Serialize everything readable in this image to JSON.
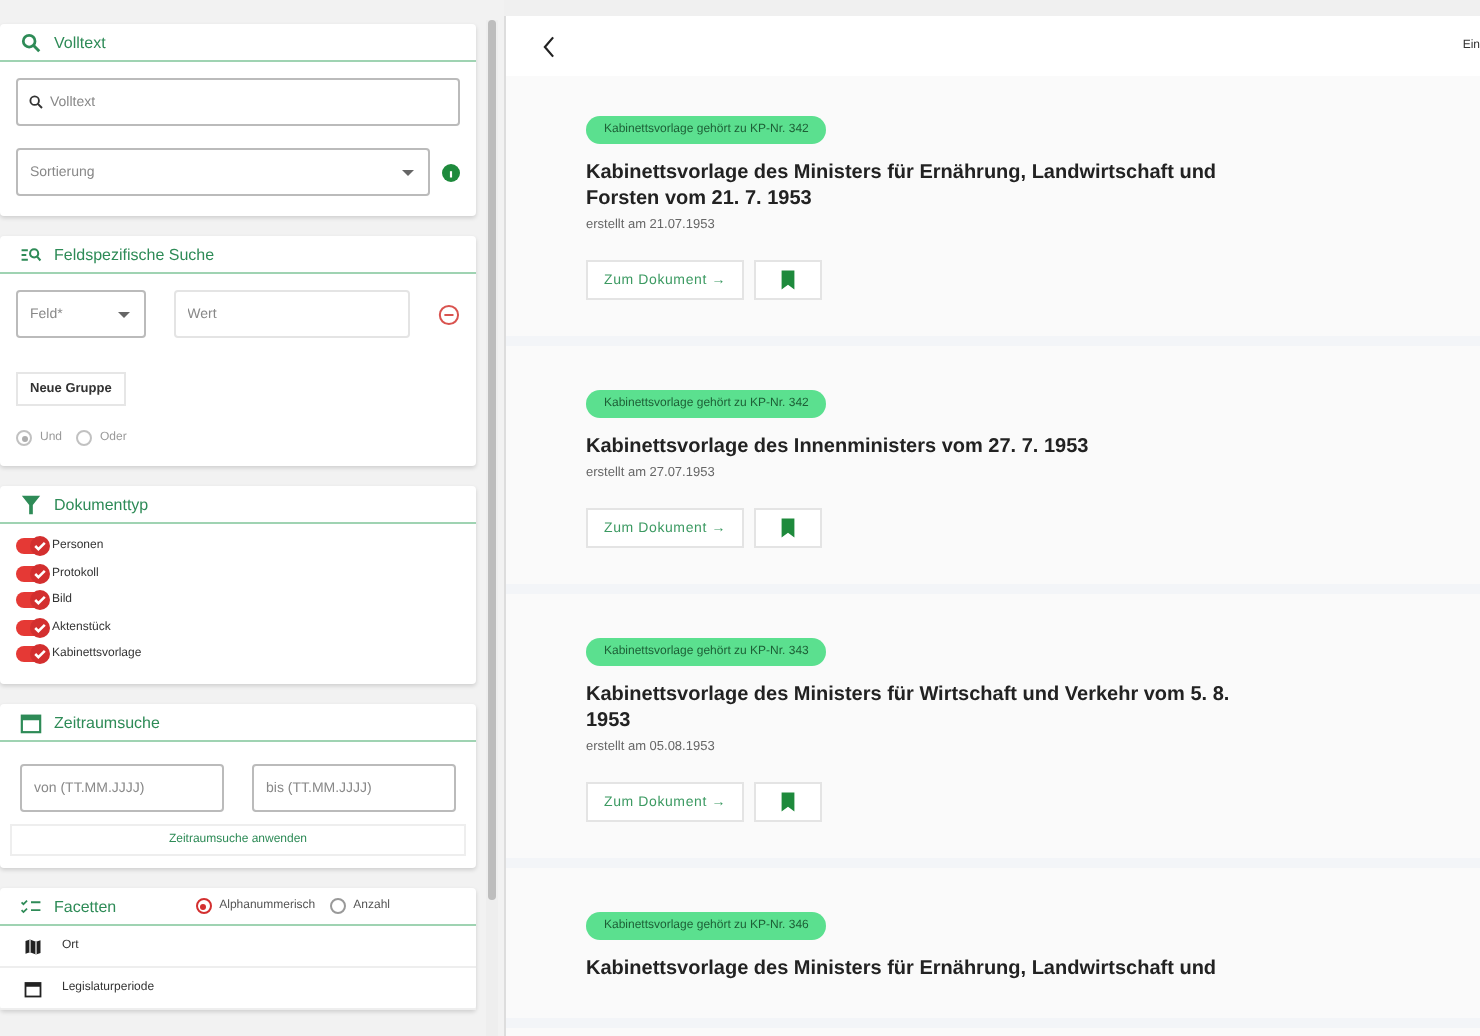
{
  "sidebar": {
    "fulltext": {
      "title": "Volltext",
      "search": {
        "placeholder": "Volltext"
      },
      "sort": {
        "placeholder": "Sortierung"
      }
    },
    "field_search": {
      "title": "Feldspezifische Suche",
      "field": {
        "placeholder": "Feld*"
      },
      "value": {
        "placeholder": "Wert"
      },
      "new_group": "Neue Gruppe",
      "logic": [
        {
          "label": "Und",
          "selected": true
        },
        {
          "label": "Oder",
          "selected": false
        }
      ]
    },
    "doc_types": {
      "title": "Dokumenttyp",
      "items": [
        {
          "label": "Personen",
          "on": true
        },
        {
          "label": "Protokoll",
          "on": true
        },
        {
          "label": "Bild",
          "on": true
        },
        {
          "label": "Aktenstück",
          "on": true
        },
        {
          "label": "Kabinettsvorlage",
          "on": true
        }
      ]
    },
    "date_range": {
      "title": "Zeitraumsuche",
      "from": {
        "placeholder": "von (TT.MM.JJJJ)"
      },
      "to": {
        "placeholder": "bis (TT.MM.JJJJ)"
      },
      "apply": "Zeitraumsuche anwenden"
    },
    "facets": {
      "title": "Facetten",
      "sort": [
        {
          "label": "Alphanummerisch",
          "selected": true
        },
        {
          "label": "Anzahl",
          "selected": false
        }
      ],
      "items": [
        {
          "label": "Ort",
          "kind": "map"
        },
        {
          "label": "Legislaturperiode",
          "kind": "calendar"
        }
      ]
    }
  },
  "header": {
    "right_text": "Ein"
  },
  "results": [
    {
      "badge": "Kabinettsvorlage gehört zu KP-Nr. 342",
      "title": "Kabinettsvorlage des Ministers für Ernährung, Landwirtschaft und Forsten vom 21. 7. 1953",
      "created": "erstellt am 21.07.1953",
      "button": "Zum Dokument →"
    },
    {
      "badge": "Kabinettsvorlage gehört zu KP-Nr. 342",
      "title": "Kabinettsvorlage des Innenministers vom 27. 7. 1953",
      "created": "erstellt am 27.07.1953",
      "button": "Zum Dokument →"
    },
    {
      "badge": "Kabinettsvorlage gehört zu KP-Nr. 343",
      "title": "Kabinettsvorlage des Ministers für Wirtschaft und Verkehr vom 5. 8. 1953",
      "created": "erstellt am 05.08.1953",
      "button": "Zum Dokument →"
    },
    {
      "badge": "Kabinettsvorlage gehört zu KP-Nr. 346",
      "title": "Kabinettsvorlage des Ministers für Ernährung, Landwirtschaft und"
    }
  ]
}
